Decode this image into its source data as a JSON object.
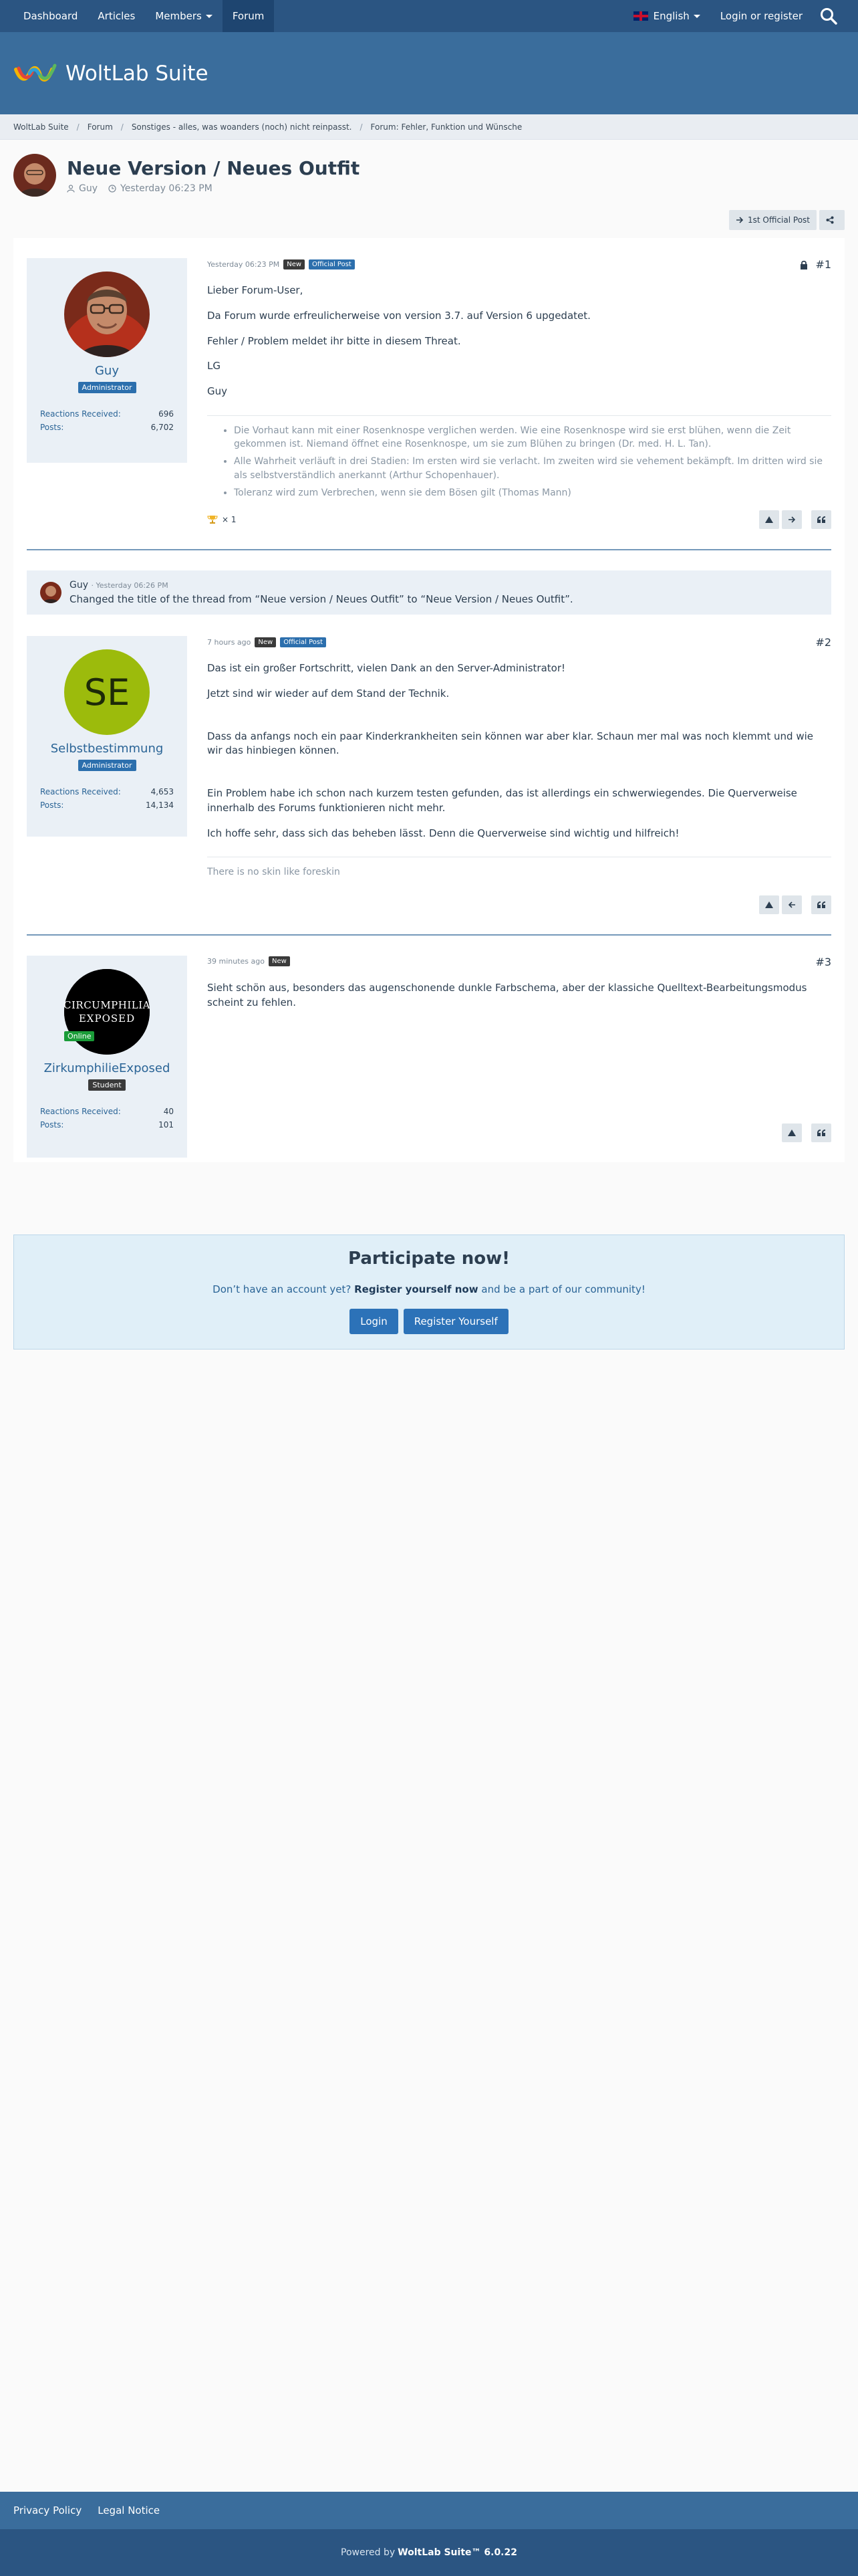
{
  "topnav": {
    "items": [
      "Dashboard",
      "Articles",
      "Members",
      "Forum"
    ],
    "language": "English",
    "login": "Login or register"
  },
  "header": {
    "logo_text": "WoltLab Suite"
  },
  "breadcrumb": [
    "WoltLab Suite",
    "Forum",
    "Sonstiges - alles, was woanders (noch) nicht reinpasst.",
    "Forum: Fehler, Funktion und Wünsche"
  ],
  "thread": {
    "title": "Neue Version / Neues Outfit",
    "author": "Guy",
    "time": "Yesterday 06:23 PM",
    "first_post_label": "1st Official Post"
  },
  "posts": [
    {
      "author": "Guy",
      "rank": "Administrator",
      "rank_color": "#2c6fad",
      "reactions_label": "Reactions Received",
      "reactions": "696",
      "posts_label": "Posts",
      "posts": "6,702",
      "time": "Yesterday 06:23 PM",
      "tag_new": "New",
      "tag_official": "Official Post",
      "number": "#1",
      "paragraphs": [
        "Lieber Forum-User,",
        "Da Forum wurde erfreulicherweise von version 3.7. auf Version 6 upgedatet.",
        "Fehler / Problem meldet ihr bitte in diesem Threat.",
        "LG",
        "Guy"
      ],
      "signature": [
        "Die Vorhaut kann mit einer Rosenknospe verglichen werden. Wie eine Rosenknospe wird sie erst blühen, wenn die Zeit gekommen ist. Niemand öffnet eine Rosenknospe, um sie zum Blühen zu bringen (Dr. med. H. L. Tan).",
        "Alle Wahrheit verläuft in drei Stadien: Im ersten wird sie verlacht. Im zweiten wird sie vehement bekämpft. Im dritten wird sie als selbstverständlich anerkannt (Arthur Schopenhauer).",
        "Toleranz wird zum Verbrechen, wenn sie dem Bösen gilt (Thomas Mann)"
      ],
      "reaction_count": "× 1"
    },
    {
      "author": "Selbstbestimmung",
      "initials": "SE",
      "rank": "Administrator",
      "rank_color": "#2c6fad",
      "reactions_label": "Reactions Received",
      "reactions": "4,653",
      "posts_label": "Posts",
      "posts": "14,134",
      "time": "7 hours ago",
      "tag_new": "New",
      "tag_official": "Official Post",
      "number": "#2",
      "paragraphs": [
        "Das ist ein großer Fortschritt, vielen Dank an den Server-Administrator!",
        "Jetzt sind wir wieder auf dem Stand der Technik.",
        "Dass da anfangs noch ein paar Kinderkrankheiten sein können war aber klar. Schaun mer mal was noch klemmt und wie wir das hinbiegen können.",
        "Ein Problem habe ich schon nach kurzem testen gefunden, das ist allerdings ein schwerwiegendes. Die Querverweise innerhalb des Forums funktionieren nicht mehr.",
        "Ich hoffe sehr, dass sich das beheben lässt. Denn die Querverweise sind wichtig und hilfreich!"
      ],
      "signature_text": "There is no skin like foreskin"
    },
    {
      "author": "ZirkumphilieExposed",
      "avatar_line1": "CIRCUMPHILIA",
      "avatar_line2": "EXPOSED",
      "online": "Online",
      "rank": "Student",
      "rank_color": "#3a3a3a",
      "reactions_label": "Reactions Received",
      "reactions": "40",
      "posts_label": "Posts",
      "posts": "101",
      "time": "39 minutes ago",
      "tag_new": "New",
      "number": "#3",
      "paragraphs": [
        "Sieht schön aus, besonders das augenschonende dunkle Farbschema, aber der klassiche Quelltext-Bearbeitungsmodus scheint zu fehlen."
      ]
    }
  ],
  "mod_notice": {
    "user": "Guy",
    "time": "· Yesterday 06:26 PM",
    "text": "Changed the title of the thread from “Neue version / Neues Outfit” to “Neue Version / Neues Outfit”."
  },
  "participate": {
    "title": "Participate now!",
    "text_before": "Don’t have an account yet?",
    "text_bold": "Register yourself now",
    "text_after": "and be a part of our community!",
    "login": "Login",
    "register": "Register Yourself"
  },
  "footer": {
    "links": [
      "Privacy Policy",
      "Legal Notice"
    ],
    "powered_prefix": "Powered by",
    "powered_brand": "WoltLab Suite™ 6.0.22"
  },
  "colors": {
    "topbar": "#2b5582",
    "header": "#3a6d9c",
    "link": "#2a6496",
    "accent": "#2c72b8"
  }
}
